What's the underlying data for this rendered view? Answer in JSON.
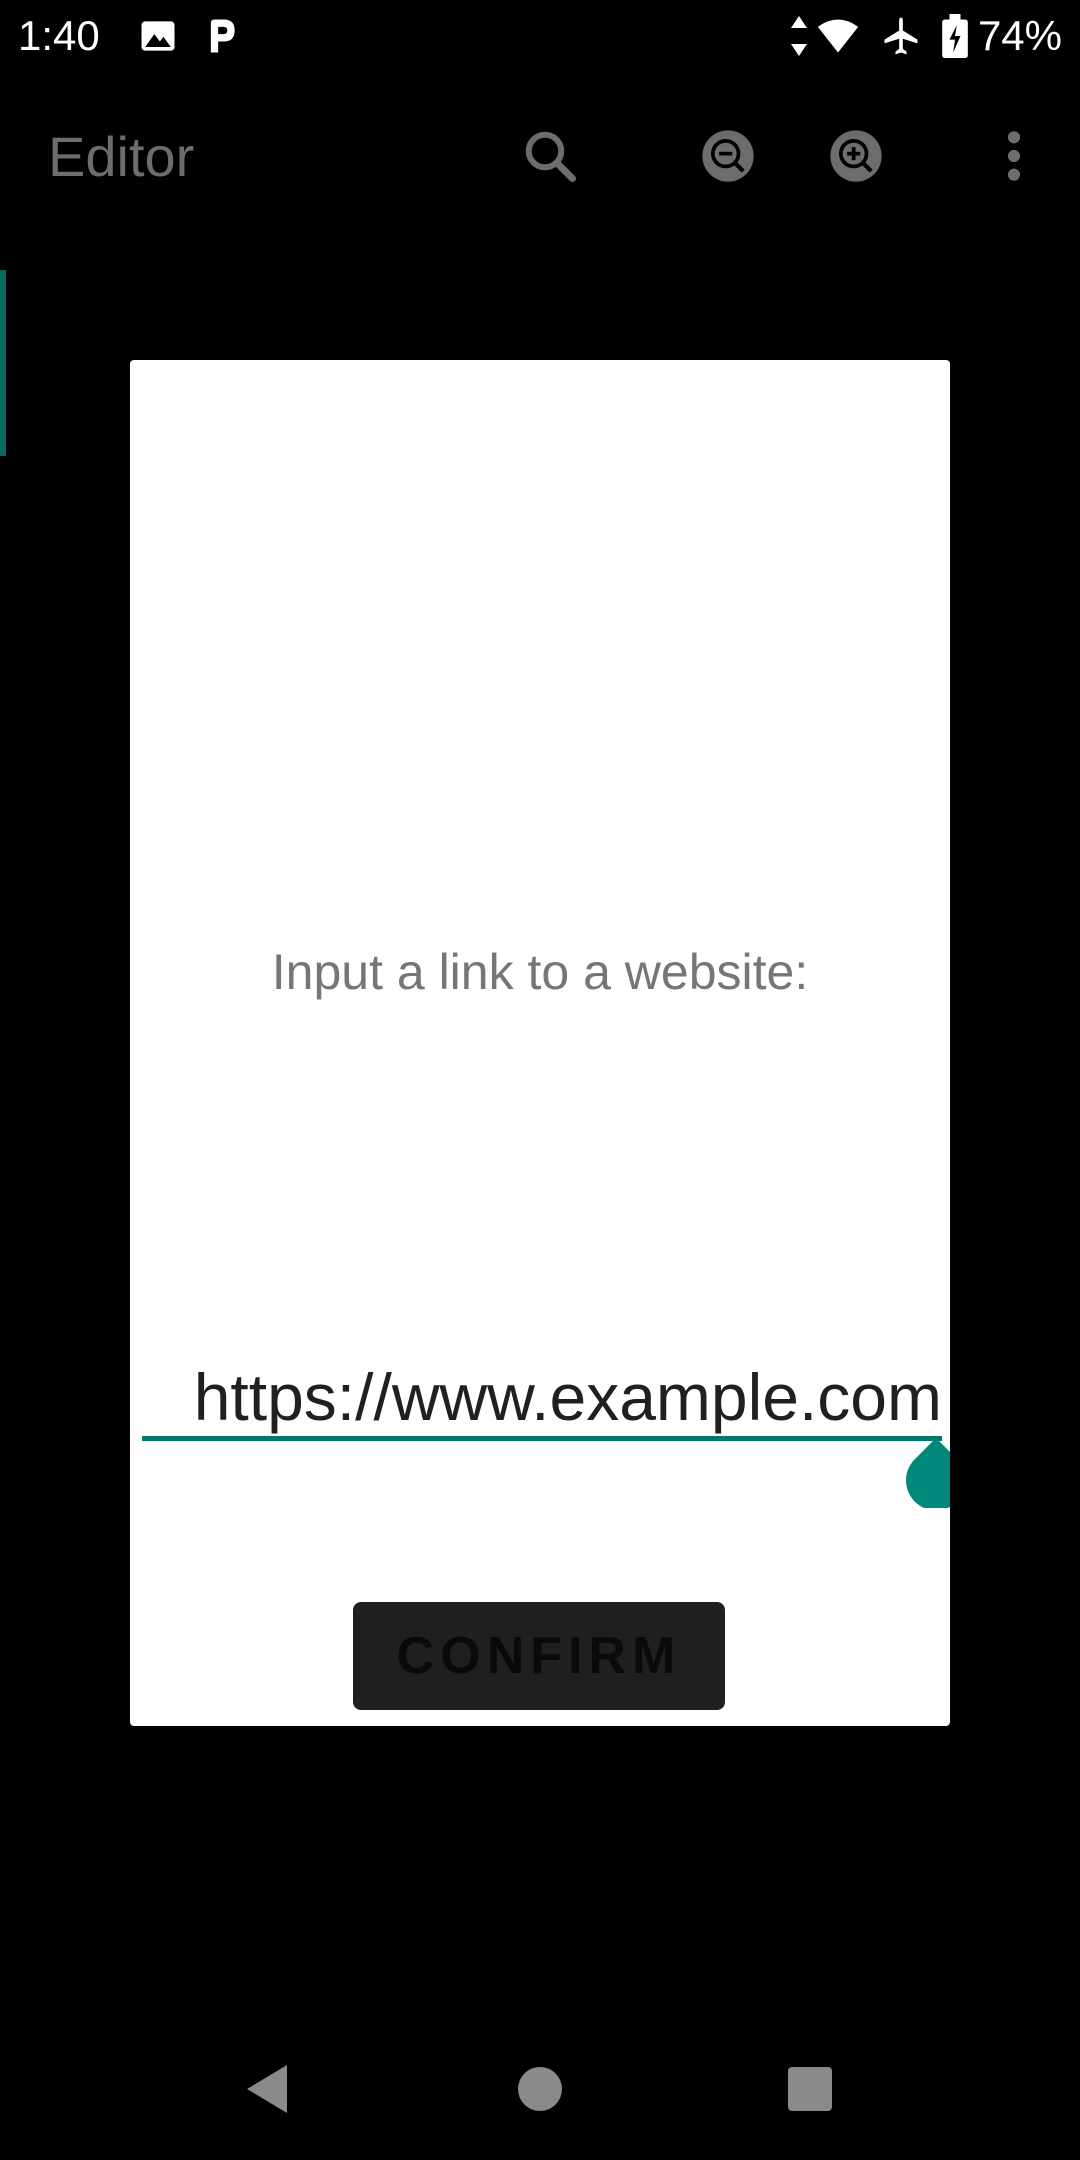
{
  "status_bar": {
    "time": "1:40",
    "battery": "74%",
    "icons": [
      "image-icon",
      "p-app-icon",
      "data-arrows-icon",
      "wifi-icon",
      "airplane-icon",
      "battery-icon"
    ]
  },
  "app_bar": {
    "title": "Editor",
    "actions": [
      "search-icon",
      "zoom-out-icon",
      "zoom-in-icon",
      "more-vert-icon"
    ]
  },
  "dialog": {
    "message": "Input a link to a website:",
    "url_value": "https://www.example.com",
    "confirm_label": "CONFIRM"
  },
  "nav_bar": {
    "buttons": [
      "back-icon",
      "home-icon",
      "recents-icon"
    ]
  },
  "colors": {
    "accent": "#00796b",
    "dialog_bg": "#ffffff",
    "title_gray": "#6d6d6d"
  }
}
